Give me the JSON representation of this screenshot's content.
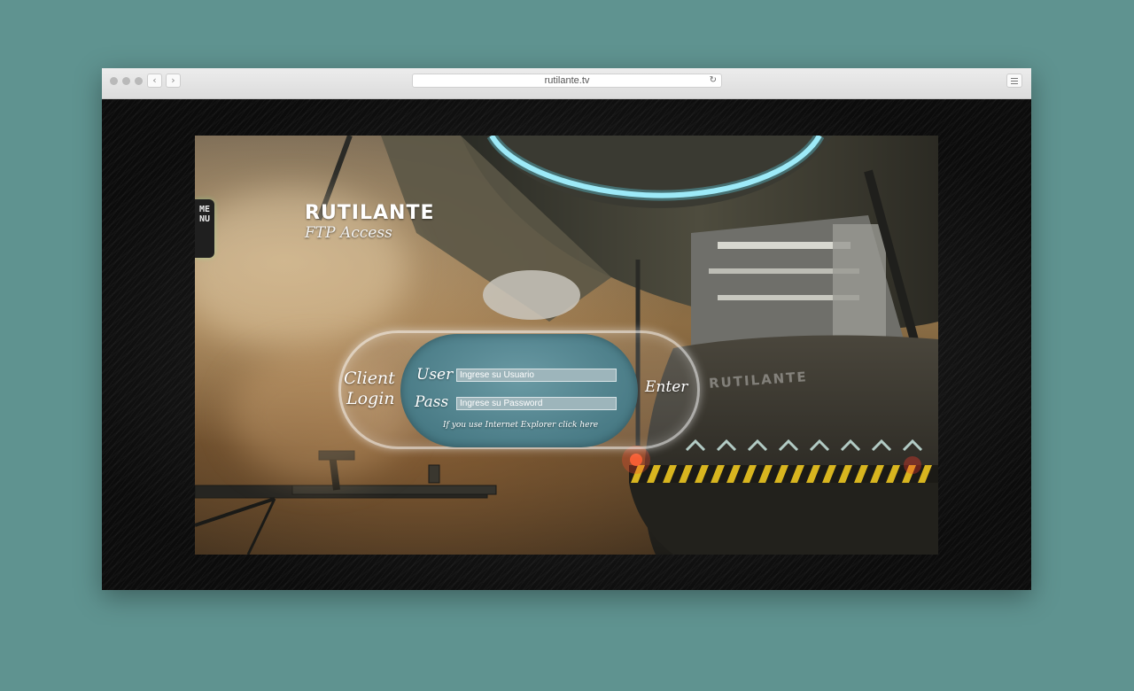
{
  "browser": {
    "url": "rutilante.tv",
    "back_icon": "chevron-left-icon",
    "forward_icon": "chevron-right-icon",
    "reload_icon": "reload-icon",
    "menu_icon": "hamburger-icon"
  },
  "site": {
    "menu_label": "MENU",
    "logo": "RUTILANTE",
    "subtitle": "FTP Access",
    "login": {
      "title_line1": "Client",
      "title_line2": "Login",
      "user_label": "User",
      "user_placeholder": "Ingrese su Usuario",
      "pass_label": "Pass",
      "pass_placeholder": "Ingrese su Password",
      "ie_note": "If you use Internet Explorer click here",
      "enter_label": "Enter"
    },
    "hull_text": "RUTILANTE"
  },
  "colors": {
    "desktop_bg": "#5f9390",
    "login_panel": "#5b8b95",
    "accent_glow": "#7fd4e0"
  }
}
